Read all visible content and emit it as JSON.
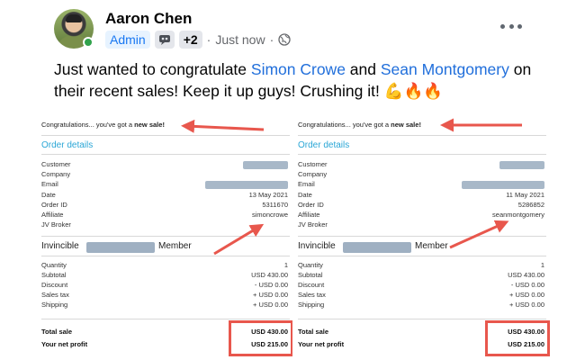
{
  "post": {
    "author": "Aaron Chen",
    "badge_admin": "Admin",
    "badge_more": "+2",
    "separator": "·",
    "time": "Just now",
    "separator2": "·",
    "text_before": "Just wanted to congratulate ",
    "mention1": "Simon Crowe",
    "text_between": " and ",
    "mention2": "Sean Montgomery",
    "text_after": " on their recent sales! Keep it up guys! Crushing it! 💪🔥🔥",
    "icons": [
      "avatar",
      "online-dot-icon",
      "community-badge-icon",
      "globe-icon",
      "more-options-icon"
    ],
    "colors": {
      "mention": "#216fdb",
      "highlight": "#e8574d",
      "section": "#2aa6d6"
    }
  },
  "receipts": [
    {
      "headline_pre": "Congratulations... you've got a ",
      "headline_bold": "new sale!",
      "section": "Order details",
      "fields": [
        {
          "label": "Customer",
          "value": ""
        },
        {
          "label": "Company",
          "value": ""
        },
        {
          "label": "Email",
          "value": ""
        },
        {
          "label": "Date",
          "value": "13 May 2021"
        },
        {
          "label": "Order ID",
          "value": "5311670"
        },
        {
          "label": "Affiliate",
          "value": "simoncrowe"
        },
        {
          "label": "JV Broker",
          "value": ""
        }
      ],
      "product_prefix": "Invincible",
      "product_suffix": "Member",
      "lines": [
        {
          "label": "Quantity",
          "value": "1"
        },
        {
          "label": "Subtotal",
          "value": "USD 430.00"
        },
        {
          "label": "Discount",
          "value": "- USD 0.00"
        },
        {
          "label": "Sales tax",
          "value": "+ USD 0.00"
        },
        {
          "label": "Shipping",
          "value": "+ USD 0.00"
        }
      ],
      "totals": [
        {
          "label": "Total sale",
          "value": "USD 430.00"
        },
        {
          "label": "Your net profit",
          "value": "USD 215.00"
        }
      ]
    },
    {
      "headline_pre": "Congratulations... you've got a ",
      "headline_bold": "new sale!",
      "section": "Order details",
      "fields": [
        {
          "label": "Customer",
          "value": ""
        },
        {
          "label": "Company",
          "value": ""
        },
        {
          "label": "Email",
          "value": ""
        },
        {
          "label": "Date",
          "value": "11 May 2021"
        },
        {
          "label": "Order ID",
          "value": "5286852"
        },
        {
          "label": "Affiliate",
          "value": "seanmontgomery"
        },
        {
          "label": "JV Broker",
          "value": ""
        }
      ],
      "product_prefix": "Invincible",
      "product_suffix": "Member",
      "lines": [
        {
          "label": "Quantity",
          "value": "1"
        },
        {
          "label": "Subtotal",
          "value": "USD 430.00"
        },
        {
          "label": "Discount",
          "value": "- USD 0.00"
        },
        {
          "label": "Sales tax",
          "value": "+ USD 0.00"
        },
        {
          "label": "Shipping",
          "value": "+ USD 0.00"
        }
      ],
      "totals": [
        {
          "label": "Total sale",
          "value": "USD 430.00"
        },
        {
          "label": "Your net profit",
          "value": "USD 215.00"
        }
      ]
    }
  ]
}
